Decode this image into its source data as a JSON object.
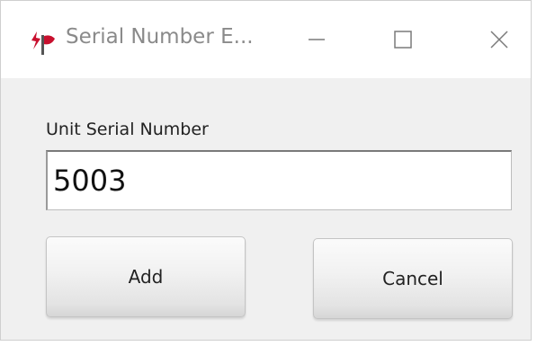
{
  "window": {
    "title": "Serial Number E...",
    "controls": {
      "minimize_icon": "minimize-icon",
      "maximize_icon": "maximize-icon",
      "close_icon": "close-icon"
    },
    "app_icon": "app-logo-icon",
    "accent_color": "#c8102e"
  },
  "form": {
    "serial_label": "Unit Serial Number",
    "serial_value": "5003"
  },
  "buttons": {
    "add_label": "Add",
    "cancel_label": "Cancel"
  }
}
